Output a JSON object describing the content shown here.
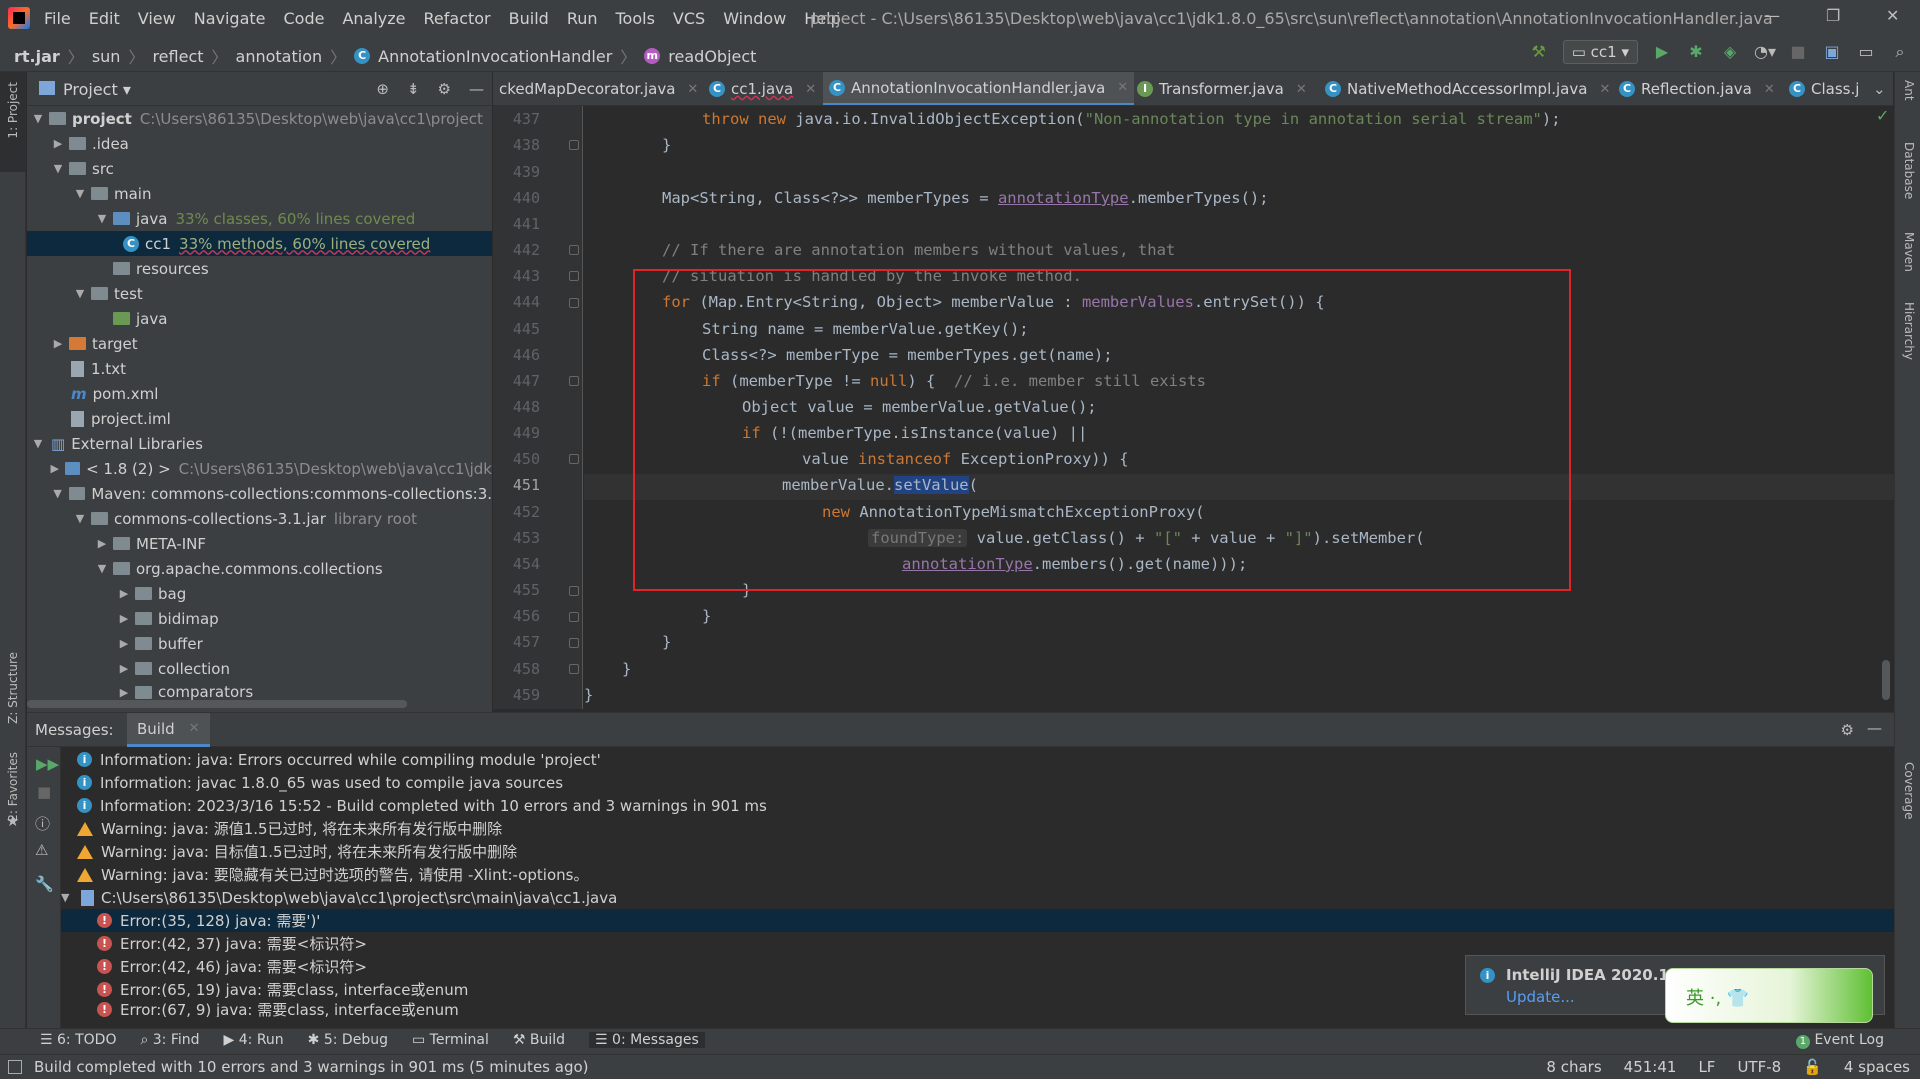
{
  "menubar": {
    "items": [
      "File",
      "Edit",
      "View",
      "Navigate",
      "Code",
      "Analyze",
      "Refactor",
      "Build",
      "Run",
      "Tools",
      "VCS",
      "Window",
      "Help"
    ],
    "title": "project - C:\\Users\\86135\\Desktop\\web\\java\\cc1\\jdk1.8.0_65\\src\\sun\\reflect\\annotation\\AnnotationInvocationHandler.java"
  },
  "navbar": {
    "crumbs": [
      "rt.jar",
      "sun",
      "reflect",
      "annotation",
      "AnnotationInvocationHandler",
      "readObject"
    ],
    "run_config": "cc1"
  },
  "left_stripe": {
    "project": "1: Project",
    "structure": "Z: Structure",
    "favorites": "2: Favorites"
  },
  "right_stripe": {
    "ant": "Ant",
    "database": "Database",
    "maven": "Maven",
    "hierarchy": "Hierarchy",
    "coverage": "Coverage"
  },
  "project_panel": {
    "title": "Project",
    "tree": [
      {
        "label": "project",
        "extra": "C:\\Users\\86135\\Desktop\\web\\java\\cc1\\project"
      },
      {
        "label": ".idea",
        "extra": ""
      },
      {
        "label": "src",
        "extra": ""
      },
      {
        "label": "main",
        "extra": ""
      },
      {
        "label": "java",
        "extra": "33% classes, 60% lines covered"
      },
      {
        "label": "cc1",
        "extra": "33% methods, 60% lines covered"
      },
      {
        "label": "resources",
        "extra": ""
      },
      {
        "label": "test",
        "extra": ""
      },
      {
        "label": "java",
        "extra": ""
      },
      {
        "label": "target",
        "extra": ""
      },
      {
        "label": "1.txt",
        "extra": ""
      },
      {
        "label": "pom.xml",
        "extra": ""
      },
      {
        "label": "project.iml",
        "extra": ""
      },
      {
        "label": "External Libraries",
        "extra": ""
      },
      {
        "label": "< 1.8 (2) >",
        "extra": "C:\\Users\\86135\\Desktop\\web\\java\\cc1\\jdk"
      },
      {
        "label": "Maven: commons-collections:commons-collections:3.",
        "extra": ""
      },
      {
        "label": "commons-collections-3.1.jar",
        "extra": "library root"
      },
      {
        "label": "META-INF",
        "extra": ""
      },
      {
        "label": "org.apache.commons.collections",
        "extra": ""
      },
      {
        "label": "bag",
        "extra": ""
      },
      {
        "label": "bidimap",
        "extra": ""
      },
      {
        "label": "buffer",
        "extra": ""
      },
      {
        "label": "collection",
        "extra": ""
      },
      {
        "label": "comparators",
        "extra": ""
      }
    ]
  },
  "tabs": [
    {
      "label": "ckedMapDecorator.java"
    },
    {
      "label": "cc1.java"
    },
    {
      "label": "AnnotationInvocationHandler.java"
    },
    {
      "label": "Transformer.java"
    },
    {
      "label": "NativeMethodAccessorImpl.java"
    },
    {
      "label": "Reflection.java"
    },
    {
      "label": "Class.j"
    }
  ],
  "editor": {
    "line_numbers": [
      "437",
      "438",
      "439",
      "440",
      "441",
      "442",
      "443",
      "444",
      "445",
      "446",
      "447",
      "448",
      "449",
      "450",
      "451",
      "452",
      "453",
      "454",
      "455",
      "456",
      "457",
      "458",
      "459"
    ],
    "code": {
      "l437a": "throw new ",
      "l437b": "java.io.InvalidObjectException(",
      "l437c": "\"Non-annotation type in annotation serial stream\"",
      "l437d": ");",
      "l438": "}",
      "l440a": "Map<String, Class<?>> memberTypes = ",
      "l440b": "annotationType",
      "l440c": ".memberTypes();",
      "l442": "// If there are annotation members without values, that",
      "l443": "// situation is handled by the invoke method.",
      "l444a": "for ",
      "l444b": "(Map.Entry<String, Object> memberValue : ",
      "l444c": "memberValues",
      "l444d": ".entrySet()) {",
      "l445": "String name = memberValue.getKey();",
      "l446": "Class<?> memberType = memberTypes.get(name);",
      "l447a": "if ",
      "l447b": "(memberType != ",
      "l447c": "null",
      "l447d": ") {  ",
      "l447e": "// i.e. member still exists",
      "l448": "Object value = memberValue.getValue();",
      "l449a": "if ",
      "l449b": "(!(memberType.isInstance(value) ||",
      "l450a": "value ",
      "l450b": "instanceof ",
      "l450c": "ExceptionProxy)) {",
      "l451a": "memberValue.",
      "l451b": "setValue",
      "l451c": "(",
      "l452a": "new ",
      "l452b": "AnnotationTypeMismatchExceptionProxy(",
      "l453a": "foundType:",
      "l453b": " value.getClass() + ",
      "l453c": "\"[\"",
      "l453d": " + value + ",
      "l453e": "\"]\"",
      "l453f": ").setMember(",
      "l454a": "annotationType",
      "l454b": ".members().get(name)));",
      "l455": "}",
      "l456": "}",
      "l457": "}",
      "l458": "}",
      "l459": "}"
    }
  },
  "messages": {
    "label": "Messages:",
    "tab": "Build",
    "rows": [
      {
        "type": "info",
        "text": "Information: java: Errors occurred while compiling module 'project'"
      },
      {
        "type": "info",
        "text": "Information: javac 1.8.0_65 was used to compile java sources"
      },
      {
        "type": "info",
        "text": "Information: 2023/3/16 15:52 - Build completed with 10 errors and 3 warnings in 901 ms"
      },
      {
        "type": "warn",
        "text": "Warning: java: 源值1.5已过时, 将在未来所有发行版中删除"
      },
      {
        "type": "warn",
        "text": "Warning: java: 目标值1.5已过时, 将在未来所有发行版中删除"
      },
      {
        "type": "warn",
        "text": "Warning: java: 要隐藏有关已过时选项的警告, 请使用 -Xlint:-options。"
      },
      {
        "type": "file",
        "text": "C:\\Users\\86135\\Desktop\\web\\java\\cc1\\project\\src\\main\\java\\cc1.java"
      },
      {
        "type": "err",
        "text": "Error:(35, 128)  java: 需要')'"
      },
      {
        "type": "err",
        "text": "Error:(42, 37)  java: 需要<标识符>"
      },
      {
        "type": "err",
        "text": "Error:(42, 46)  java: 需要<标识符>"
      },
      {
        "type": "err",
        "text": "Error:(65, 19)  java: 需要class, interface或enum"
      },
      {
        "type": "err",
        "text": "Error:(67, 9)  java: 需要class, interface或enum"
      }
    ]
  },
  "notification": {
    "title": "IntelliJ IDEA 2020.1.4",
    "link": "Update..."
  },
  "ime": {
    "chars": "英 ·, 👕"
  },
  "toolbuttons": [
    "6: TODO",
    "3: Find",
    "4: Run",
    "5: Debug",
    "Terminal",
    "Build",
    "0: Messages"
  ],
  "event_log": "Event Log",
  "statusbar": {
    "message": "Build completed with 10 errors and 3 warnings in 901 ms (5 minutes ago)",
    "chars": "8 chars",
    "position": "451:41",
    "line_sep": "LF",
    "encoding": "UTF-8",
    "indent": "4 spaces"
  }
}
